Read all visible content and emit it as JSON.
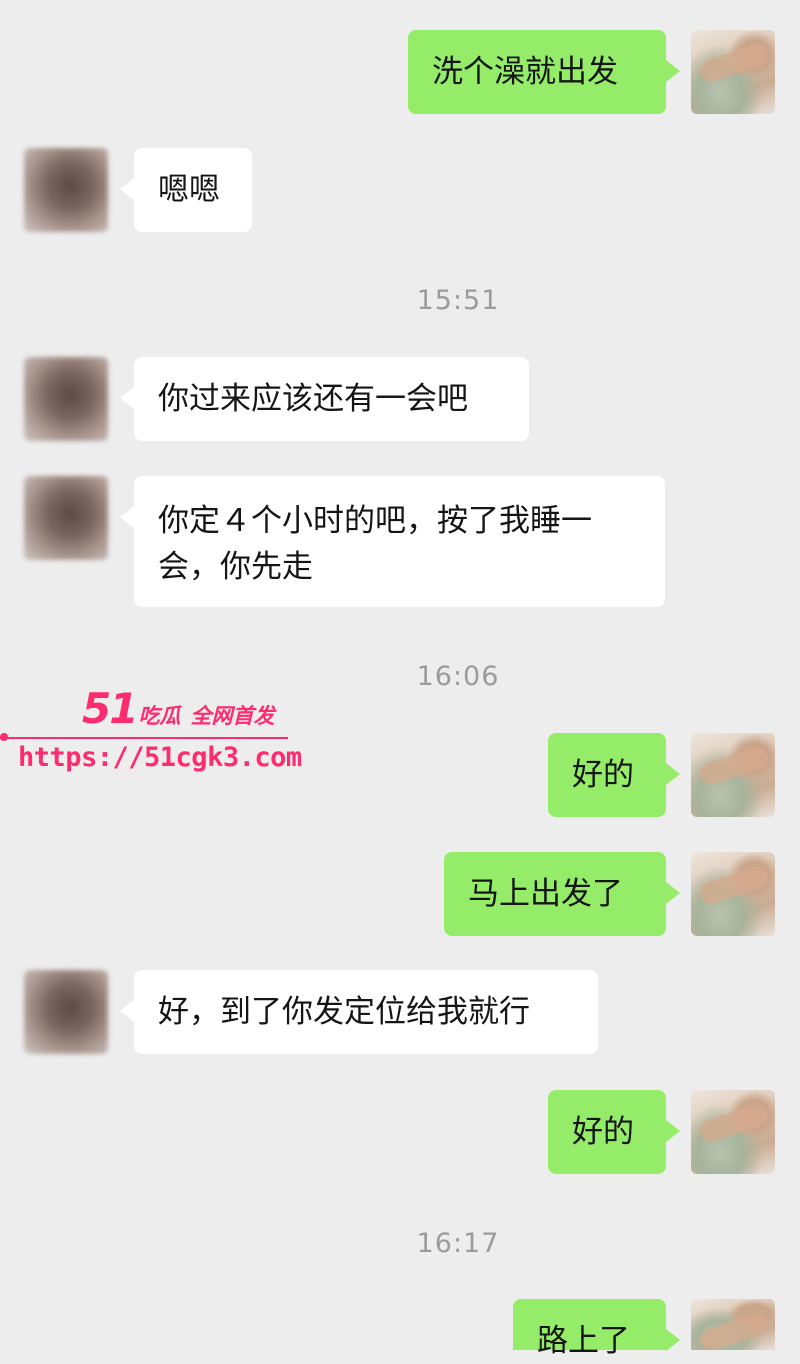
{
  "messages": [
    {
      "side": "right",
      "text": "洗个澡就出发"
    },
    {
      "side": "left",
      "text": "嗯嗯"
    },
    {
      "side": "left",
      "text": "你过来应该还有一会吧"
    },
    {
      "side": "left",
      "text": "你定４个小时的吧，按了我睡一会，你先走"
    },
    {
      "side": "right",
      "text": "好的"
    },
    {
      "side": "right",
      "text": "马上出发了"
    },
    {
      "side": "left",
      "text": "好，到了你发定位给我就行"
    },
    {
      "side": "right",
      "text": "好的"
    },
    {
      "side": "right",
      "text": "路上了"
    }
  ],
  "timestamps": [
    "15:51",
    "16:06",
    "16:17"
  ],
  "watermark": {
    "number": "51",
    "name": "吃瓜",
    "tag": "全网首发",
    "url": "https://51cgk3.com",
    "color": "#ff2b6e"
  },
  "colors": {
    "background": "#ededed",
    "outgoing_bubble": "#95ec69",
    "incoming_bubble": "#ffffff",
    "timestamp_text": "#9b9b9b"
  },
  "icons": {
    "contact_avatar": "blurred-avatar",
    "self_avatar": "photo-avatar"
  }
}
